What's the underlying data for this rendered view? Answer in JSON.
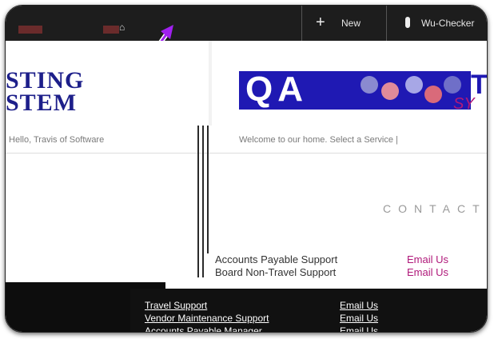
{
  "topbar": {
    "new_label": "New",
    "user_label": "Wu-Checker"
  },
  "banner": {
    "logo_line1": "STING",
    "logo_line2": "STEM",
    "qa_text": "QA",
    "right_letter": "T",
    "right_fragment": "SY"
  },
  "subnav": {
    "left_text": "Hello, Travis of Software",
    "right_text": "Welcome to our home. Select a Service  |"
  },
  "contact": {
    "heading": "CONTACT"
  },
  "support_rows": [
    {
      "label": "Accounts Payable Support",
      "link": "Email Us"
    },
    {
      "label": "Board Non-Travel Support",
      "link": "Email Us"
    }
  ],
  "dark_rows": [
    {
      "label": "Travel Support",
      "link": "Email Us"
    },
    {
      "label": "Vendor Maintenance Support",
      "link": "Email Us"
    },
    {
      "label": "Accounts Payable Manager",
      "link": "Email Us"
    }
  ],
  "colors": {
    "brand_blue": "#1f19b3",
    "link_magenta": "#b0197a",
    "arrow_purple": "#a020f0"
  }
}
